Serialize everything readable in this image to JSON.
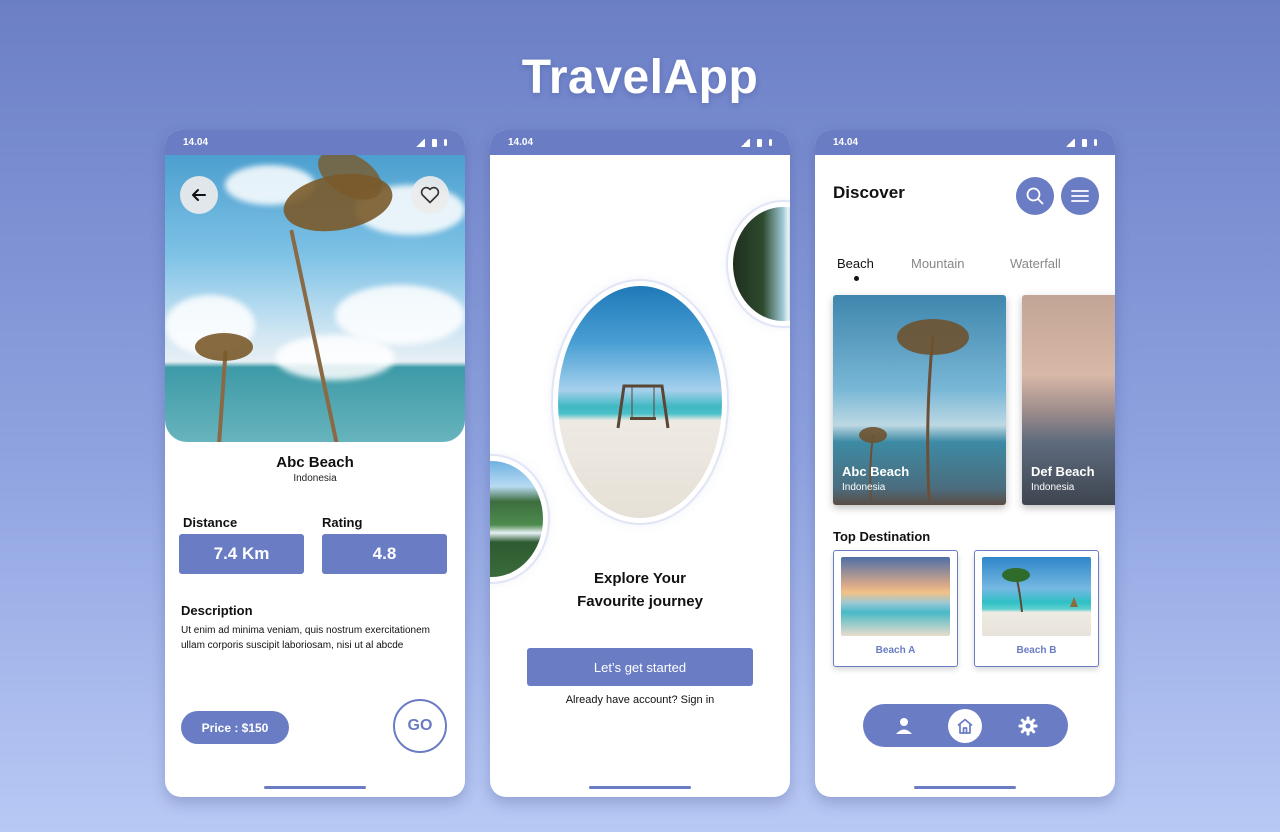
{
  "app_title": "TravelApp",
  "status_time": "14.04",
  "colors": {
    "accent": "#6a7cc4",
    "background_top": "#6c7fc6",
    "background_bottom": "#b9c9f5"
  },
  "detail": {
    "place_name": "Abc Beach",
    "country": "Indonesia",
    "distance_label": "Distance",
    "distance_value": "7.4 Km",
    "rating_label": "Rating",
    "rating_value": "4.8",
    "description_title": "Description",
    "description_text": "Ut enim ad minima veniam, quis nostrum exercitationem ullam corporis suscipit laboriosam, nisi ut al  abcde",
    "price": "Price : $150",
    "go_label": "GO",
    "icons": {
      "back": "arrow-left-icon",
      "favorite": "heart-icon"
    }
  },
  "onboarding": {
    "heading_line1": "Explore Your",
    "heading_line2": "Favourite journey",
    "cta_label": "Let’s get started",
    "signin_text": "Already have account? Sign in"
  },
  "discover": {
    "title": "Discover",
    "icons": {
      "search": "search-icon",
      "menu": "menu-icon"
    },
    "tabs": [
      "Beach",
      "Mountain",
      "Waterfall"
    ],
    "active_tab": "Beach",
    "cards": [
      {
        "name": "Abc Beach",
        "country": "Indonesia"
      },
      {
        "name": "Def Beach",
        "country": "Indonesia"
      }
    ],
    "top_destination_title": "Top Destination",
    "destinations": [
      {
        "label": "Beach A"
      },
      {
        "label": "Beach B"
      }
    ],
    "nav": [
      "user-icon",
      "home-icon",
      "gear-icon"
    ],
    "active_nav": "home-icon"
  }
}
